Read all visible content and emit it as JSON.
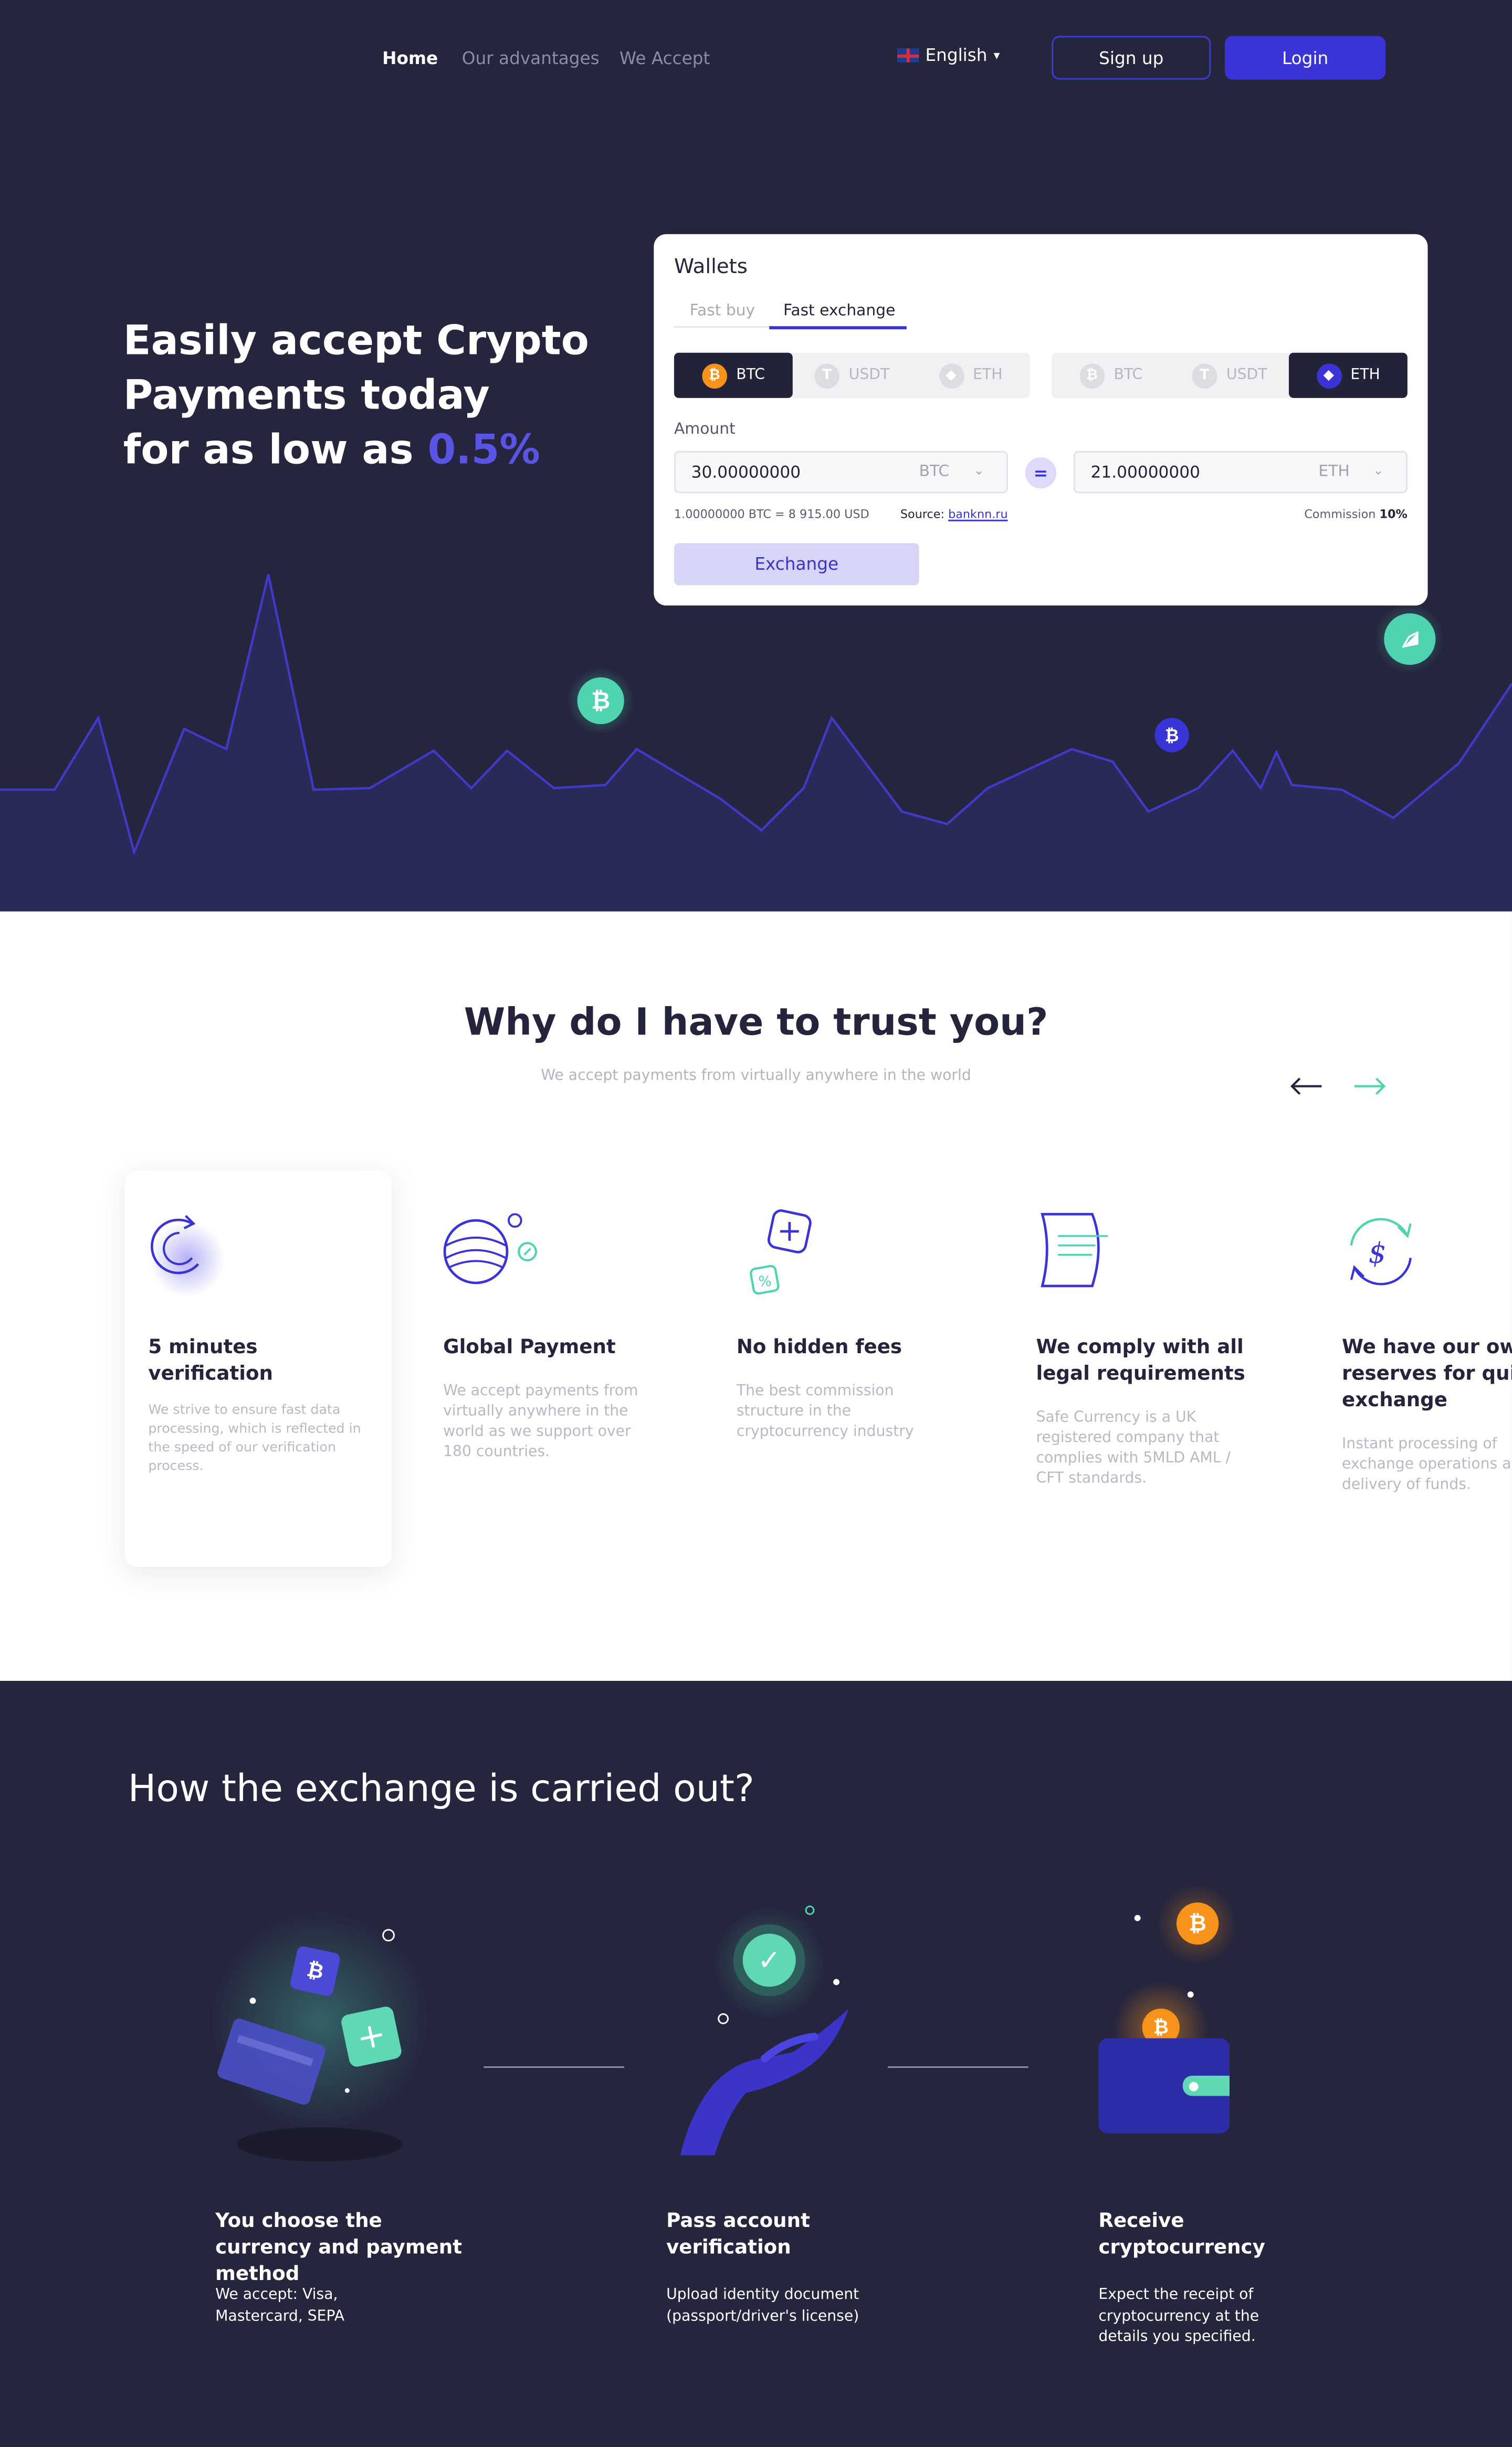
{
  "nav": {
    "items": [
      {
        "label": "Home"
      },
      {
        "label": "Our advantages"
      },
      {
        "label": "We Accept"
      }
    ]
  },
  "header": {
    "language": "English",
    "signup": "Sign up",
    "login": "Login"
  },
  "hero": {
    "title_line1": "Easily accept Crypto",
    "title_line2": "Payments today",
    "title_line3": "for as low as",
    "title_accent": "0.5%"
  },
  "wallet": {
    "title": "Wallets",
    "tabs": [
      "Fast buy",
      "Fast exchange"
    ],
    "active_tab": "Fast exchange",
    "from_coins": [
      "BTC",
      "USDT",
      "ETH"
    ],
    "to_coins": [
      "BTC",
      "USDT",
      "ETH"
    ],
    "from_selected": "BTC",
    "to_selected": "ETH",
    "amount_label": "Amount",
    "from_value": "30.00000000",
    "from_currency": "BTC",
    "to_value": "21.00000000",
    "to_currency": "ETH",
    "equals": "=",
    "rate": "1.00000000 BTC = 8 915.00 USD",
    "source_label": "Source:",
    "source_link": "banknn.ru",
    "commission_label": "Commission",
    "commission_value": "10%",
    "exchange_button": "Exchange"
  },
  "trust": {
    "title": "Why do I have to trust you?",
    "subtitle": "We accept payments from virtually anywhere in the world",
    "features": [
      {
        "title": "5 minutes verification",
        "text": "We strive to ensure fast data processing, which is reflected in the speed of our verification process."
      },
      {
        "title": "Global Payment",
        "text": "We accept payments from virtually anywhere in the world as we support over 180 countries."
      },
      {
        "title": "No hidden fees",
        "text": "The best commission structure in the cryptocurrency industry"
      },
      {
        "title": "We comply with all legal requirements",
        "text": "Safe Currency is a UK registered company that complies with 5MLD AML / CFT standards."
      },
      {
        "title": "We have our own reserves for quick exchange",
        "text": "Instant processing of exchange operations and delivery of funds."
      }
    ]
  },
  "how": {
    "title": "How the exchange is carried out?",
    "steps": [
      {
        "title": "You choose the currency and payment method",
        "text": "We accept: Visa, Mastercard, SEPA"
      },
      {
        "title": "Pass account verification",
        "text": "Upload identity document (passport/driver's license)"
      },
      {
        "title": "Receive cryptocurrency",
        "text": "Expect the receipt of cryptocurrency at the details you specified."
      }
    ]
  },
  "colors": {
    "dark_bg": "#25253d",
    "accent": "#3a34d6",
    "teal": "#4fd3b0",
    "orange": "#f7931a"
  }
}
